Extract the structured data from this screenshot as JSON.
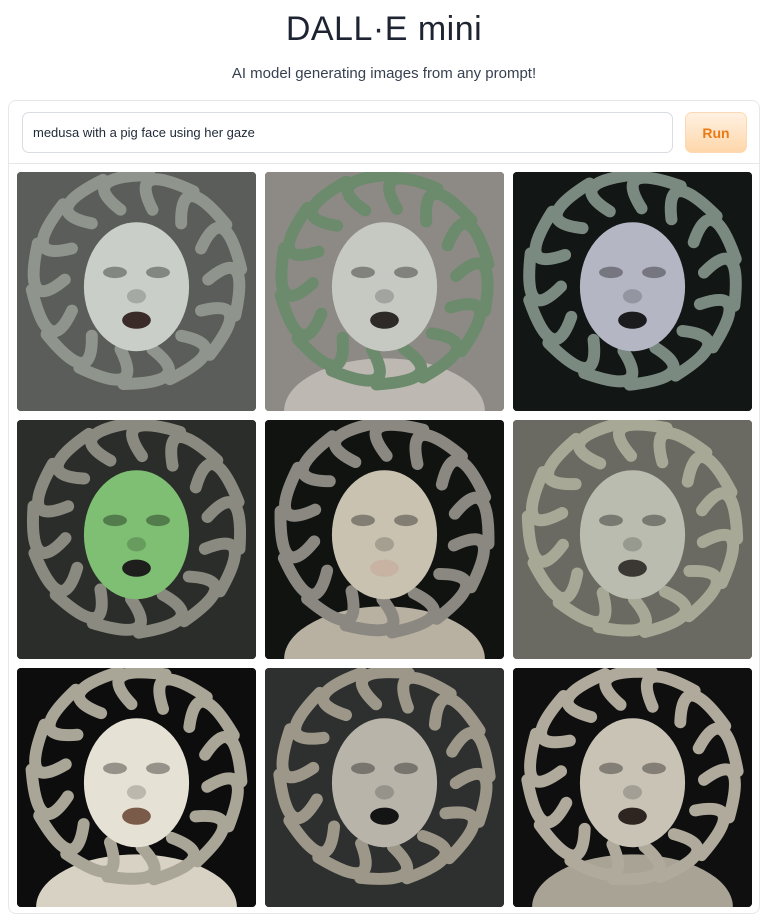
{
  "header": {
    "title": "DALL·E mini",
    "subtitle": "AI model generating images from any prompt!"
  },
  "prompt": {
    "value": "medusa with a pig face using her gaze",
    "placeholder": ""
  },
  "run_button": {
    "label": "Run"
  },
  "colors": {
    "accent": "#ea7a16",
    "run_bg_top": "#fff1e2",
    "run_bg_bottom": "#fed7aa",
    "border": "#e5e7eb"
  },
  "gallery": {
    "images": [
      {
        "name": "medusa-image-1",
        "bg": "#5a5d59",
        "face": "#c9cfc8",
        "snake": "#8f958c",
        "mouth": "#3a2a28",
        "body": ""
      },
      {
        "name": "medusa-image-2",
        "bg": "#8d8a86",
        "face": "#c6c8c2",
        "snake": "#6c8a6c",
        "mouth": "#2d2a28",
        "body": "#bdb8b1"
      },
      {
        "name": "medusa-image-3",
        "bg": "#121614",
        "face": "#b4b6c4",
        "snake": "#7a8a80",
        "mouth": "#1b1b1e",
        "body": ""
      },
      {
        "name": "medusa-image-4",
        "bg": "#2b2d2a",
        "face": "#7fbf73",
        "snake": "#8a8a80",
        "mouth": "#1e1f1c",
        "body": ""
      },
      {
        "name": "medusa-image-5",
        "bg": "#111311",
        "face": "#c9c2b1",
        "snake": "#8a8880",
        "mouth": "#c8b2a2",
        "body": "#b8b1a2"
      },
      {
        "name": "medusa-image-6",
        "bg": "#6b6a62",
        "face": "#b9bcae",
        "snake": "#a7a895",
        "mouth": "#3b3833",
        "body": ""
      },
      {
        "name": "medusa-image-7",
        "bg": "#0d0d0d",
        "face": "#e6e1d5",
        "snake": "#a9a597",
        "mouth": "#7a5a48",
        "body": "#d8d2c5"
      },
      {
        "name": "medusa-image-8",
        "bg": "#2d302f",
        "face": "#b8b4aa",
        "snake": "#9d9789",
        "mouth": "#141414",
        "body": ""
      },
      {
        "name": "medusa-image-9",
        "bg": "#0f0f0f",
        "face": "#c9c3b6",
        "snake": "#b0aa9c",
        "mouth": "#2e2520",
        "body": "#a9a396"
      }
    ]
  }
}
